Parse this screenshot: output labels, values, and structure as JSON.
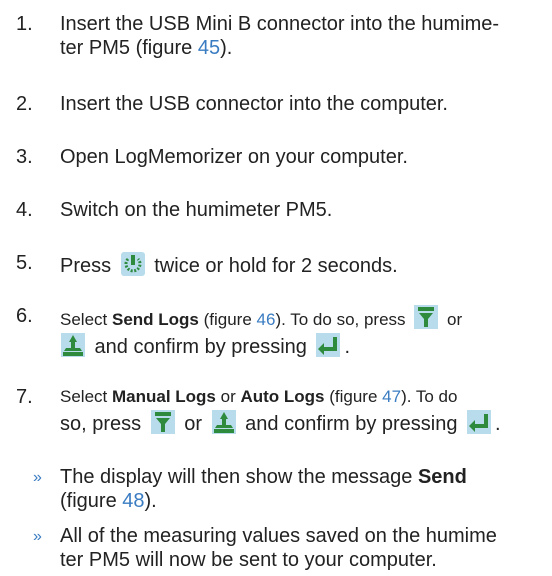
{
  "steps": [
    {
      "num": "1.",
      "pre": "Insert the USB Mini B connector into the humime-",
      "line2": "ter PM5 (figure ",
      "fig": "45",
      "post": ")."
    },
    {
      "num": "2.",
      "text": "Insert the USB connector into the computer."
    },
    {
      "num": "3.",
      "text": "Open LogMemorizer on your computer."
    },
    {
      "num": "4.",
      "text": "Switch on the humimeter PM5."
    },
    {
      "num": "5.",
      "pre": "Press ",
      "post": " twice or hold for 2 seconds."
    },
    {
      "num": "6.",
      "pre": "Select ",
      "bold": "Send Logs",
      "mid": " (figure ",
      "fig": "46",
      "mid2": "). To do so, press ",
      "or": " or",
      "line2": " and confirm by pressing ",
      "end": "."
    },
    {
      "num": "7.",
      "pre": "Select ",
      "bold": "Manual Logs",
      "or_word": " or ",
      "bold2": "Auto Logs",
      "mid": " (figure ",
      "fig": "47",
      "mid2": "). To do",
      "line2_pre": "so, press ",
      "or": " or ",
      "line2": " and confirm by pressing ",
      "end": "."
    }
  ],
  "bullets": [
    {
      "symbol": "»",
      "pre": "The display will then show the message ",
      "bold": "Send",
      "line2": "(figure ",
      "fig": "48",
      "post": ")."
    },
    {
      "symbol": "»",
      "text": "All of the measuring values saved on the humime",
      "line2": "ter PM5 will now be sent to your computer."
    }
  ],
  "icons": {
    "power": "power-button-icon",
    "down": "down-arrow-icon",
    "up": "up-arrow-icon",
    "enter": "enter-icon"
  },
  "colors": {
    "link": "#3a7cc2",
    "icon_green": "#2e8b3e",
    "icon_bg": "#b8dceb"
  }
}
